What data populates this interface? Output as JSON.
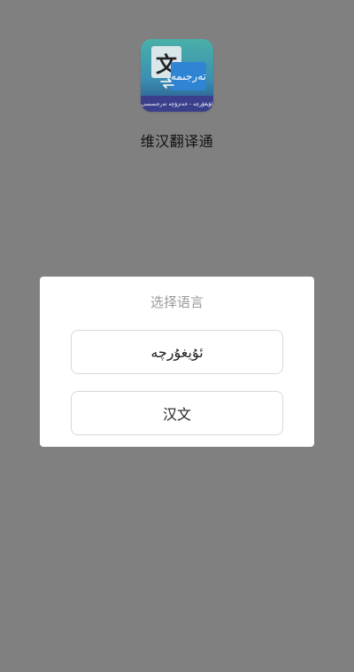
{
  "app": {
    "name": "维汉翻译通",
    "icon_main_glyph": "文",
    "icon_secondary_text": "تەرجىمە",
    "icon_strip_text": "ئۇيغۇرچە - خەنزۇچە تەرجىمىسى"
  },
  "dialog": {
    "title": "选择语言",
    "options": [
      {
        "label": "ئۇيغۇرچە"
      },
      {
        "label": "汉文"
      }
    ]
  }
}
